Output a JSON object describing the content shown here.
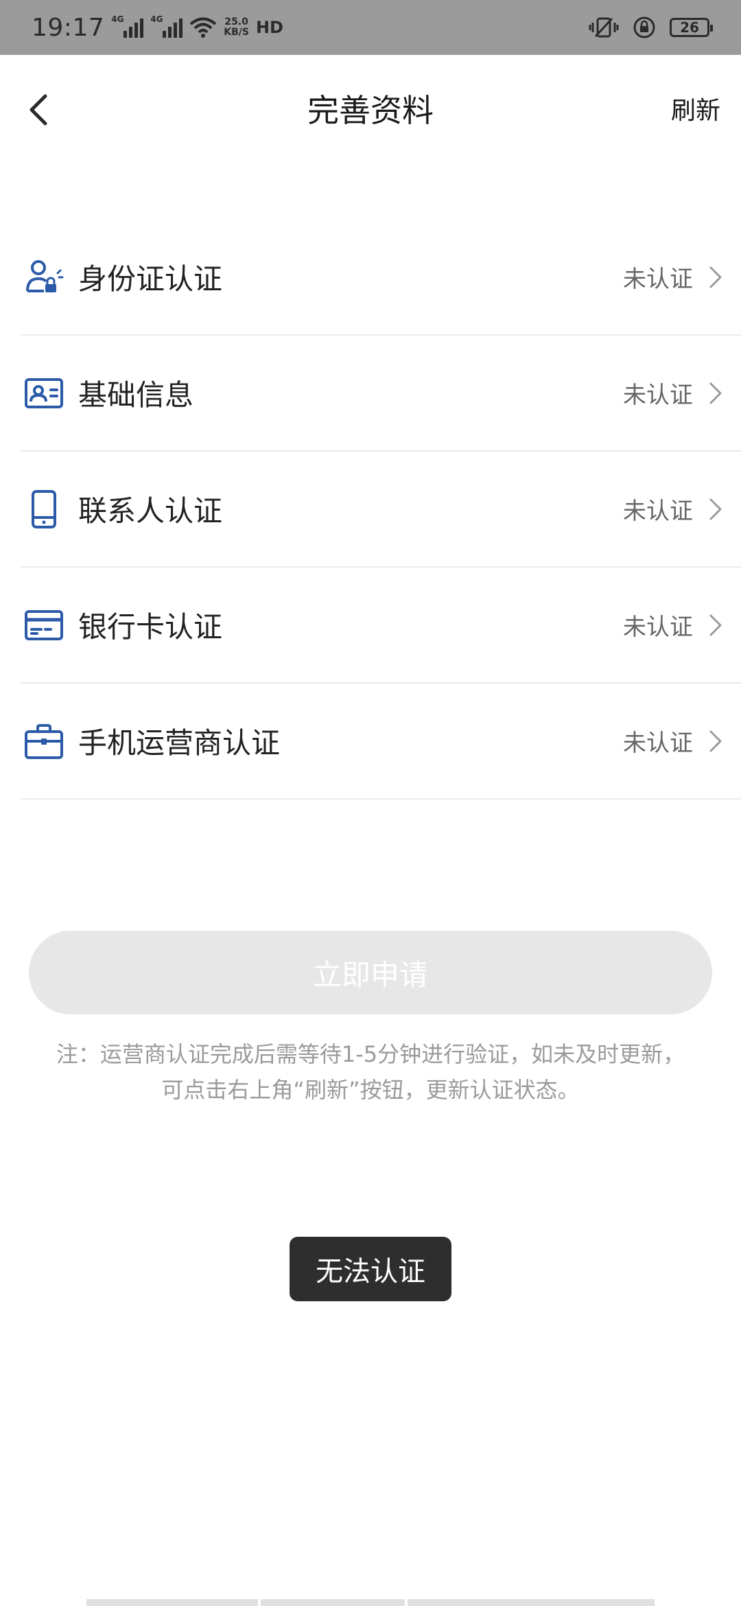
{
  "status_bar": {
    "time": "19:17",
    "network_tag_1": "4G",
    "network_tag_2": "4G",
    "speed_value": "25.0",
    "speed_unit": "KB/S",
    "hd_label": "HD",
    "battery": "26"
  },
  "header": {
    "title": "完善资料",
    "refresh_label": "刷新"
  },
  "items": [
    {
      "label": "身份证认证",
      "status": "未认证",
      "icon": "id-person-icon"
    },
    {
      "label": "基础信息",
      "status": "未认证",
      "icon": "id-card-icon"
    },
    {
      "label": "联系人认证",
      "status": "未认证",
      "icon": "phone-icon"
    },
    {
      "label": "银行卡认证",
      "status": "未认证",
      "icon": "bank-card-icon"
    },
    {
      "label": "手机运营商认证",
      "status": "未认证",
      "icon": "briefcase-icon"
    }
  ],
  "apply_button_label": "立即申请",
  "note_line1": "注：运营商认证完成后需等待1-5分钟进行验证，如未及时更新，",
  "note_line2": "可点击右上角“刷新”按钮，更新认证状态。",
  "toast_text": "无法认证",
  "colors": {
    "status_bar_bg": "#9b9b9b",
    "icon_blue": "#2b5aa8",
    "toast_bg": "#2e2e2e",
    "button_disabled_bg": "#e7e7e7"
  }
}
